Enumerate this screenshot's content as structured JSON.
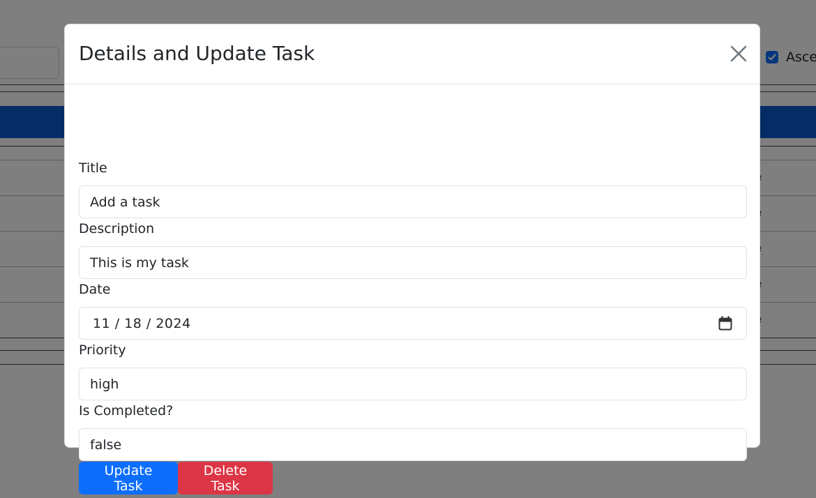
{
  "background": {
    "sort_label": "Asce",
    "row_fragments": [
      "e",
      "e",
      "e",
      "e",
      "e"
    ]
  },
  "modal": {
    "title": "Details and Update Task",
    "close_icon": "close-icon",
    "fields": {
      "title": {
        "label": "Title",
        "value": "Add a task"
      },
      "description": {
        "label": "Description",
        "value": "This is my task"
      },
      "date": {
        "label": "Date",
        "value": "11 / 18 / 2024"
      },
      "priority": {
        "label": "Priority",
        "value": "high"
      },
      "completed": {
        "label": "Is Completed?",
        "value": "false"
      }
    },
    "buttons": {
      "update_label": "Update Task",
      "delete_label": "Delete Task"
    }
  },
  "colors": {
    "primary": "#0d6efd",
    "danger": "#dc3545",
    "header_bar": "#0a58ca",
    "backdrop": "rgba(0,0,0,0.5)"
  }
}
